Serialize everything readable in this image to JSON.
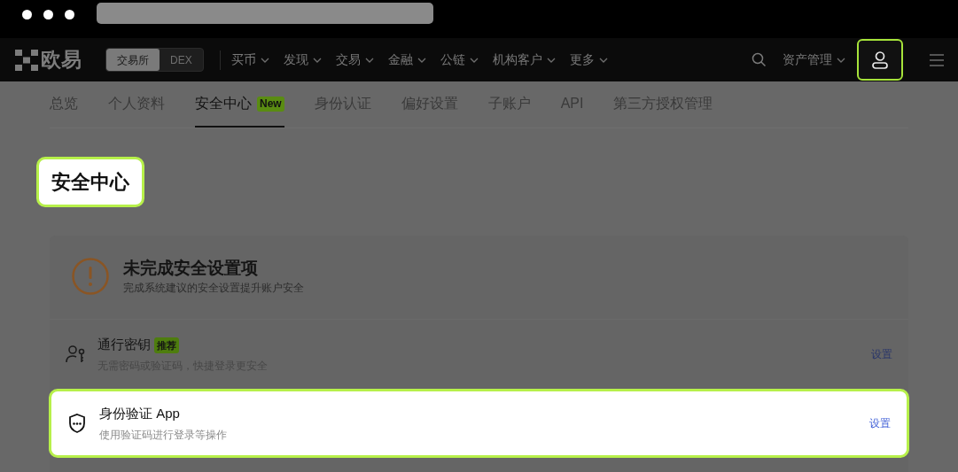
{
  "nav": {
    "logo": "欧易",
    "mode_toggle": [
      {
        "label": "交易所",
        "selected": true
      },
      {
        "label": "DEX",
        "selected": false
      }
    ],
    "menu": [
      "买币",
      "发现",
      "交易",
      "金融",
      "公链",
      "机构客户",
      "更多"
    ],
    "assets": "资产管理",
    "profile": {
      "highlighted": true
    }
  },
  "tabs": [
    {
      "label": "总览",
      "selected": false
    },
    {
      "label": "个人资料",
      "selected": false
    },
    {
      "label": "安全中心",
      "selected": true,
      "badge": "New"
    },
    {
      "label": "身份认证",
      "selected": false
    },
    {
      "label": "偏好设置",
      "selected": false
    },
    {
      "label": "子账户",
      "selected": false
    },
    {
      "label": "API",
      "selected": false
    },
    {
      "label": "第三方授权管理",
      "selected": false
    }
  ],
  "page_title": {
    "text": "安全中心",
    "highlighted": true
  },
  "alert": {
    "title": "未完成安全设置项",
    "subtitle": "完成系统建议的安全设置提升账户安全"
  },
  "security_items": [
    {
      "kind": "passkey",
      "title": "通行密钥",
      "badge": "推荐",
      "description": "无需密码或验证码，快捷登录更安全",
      "action": "设置",
      "highlighted": false
    },
    {
      "kind": "authenticator",
      "title": "身份验证 App",
      "description": "使用验证码进行登录等操作",
      "action": "设置",
      "highlighted": true
    }
  ]
}
